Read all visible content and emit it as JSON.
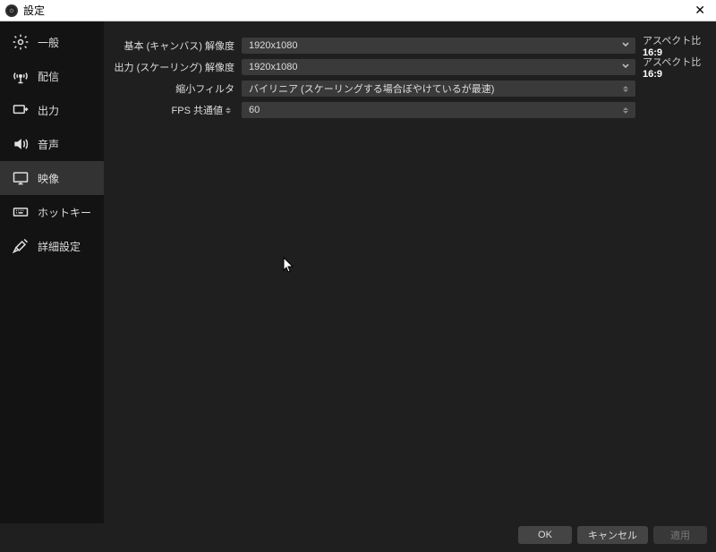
{
  "window": {
    "title": "設定"
  },
  "sidebar": {
    "items": [
      {
        "label": "一般"
      },
      {
        "label": "配信"
      },
      {
        "label": "出力"
      },
      {
        "label": "音声"
      },
      {
        "label": "映像"
      },
      {
        "label": "ホットキー"
      },
      {
        "label": "詳細設定"
      }
    ],
    "active_index": 4
  },
  "form": {
    "base_resolution": {
      "label": "基本 (キャンバス) 解像度",
      "value": "1920x1080",
      "aspect_label": "アスペクト比",
      "aspect_value": "16:9"
    },
    "output_resolution": {
      "label": "出力 (スケーリング) 解像度",
      "value": "1920x1080",
      "aspect_label": "アスペクト比",
      "aspect_value": "16:9"
    },
    "downscale_filter": {
      "label": "縮小フィルタ",
      "value": "バイリニア (スケーリングする場合ぼやけているが最速)"
    },
    "fps": {
      "label": "FPS 共通値",
      "value": "60"
    }
  },
  "footer": {
    "ok": "OK",
    "cancel": "キャンセル",
    "apply": "適用"
  }
}
